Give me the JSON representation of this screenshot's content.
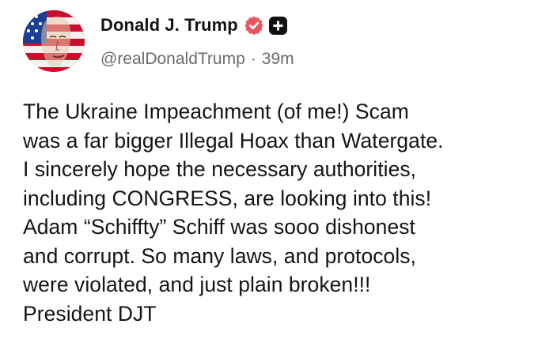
{
  "author": {
    "display_name": "Donald J. Trump",
    "handle": "@realDonaldTrump",
    "separator": "·",
    "time_ago": "39m",
    "avatar_icon": "stars-and-stripes-portrait-avatar",
    "verified_icon": "verified-badge-icon",
    "plus_icon": "plus-badge-icon"
  },
  "post": {
    "text": "The Ukraine Impeachment (of me!) Scam\nwas a far bigger Illegal Hoax than Watergate.\nI sincerely hope the necessary authorities,\nincluding CONGRESS, are looking into this!\nAdam “Schiffty” Schiff was sooo dishonest\nand corrupt. So many laws, and protocols,\nwere violated, and just plain broken!!!\nPresident DJT"
  },
  "colors": {
    "verified_badge": "#e8555b",
    "text": "#141414",
    "muted": "#6a6a70",
    "flag_red": "#c8102e",
    "flag_blue": "#1c3f94"
  }
}
